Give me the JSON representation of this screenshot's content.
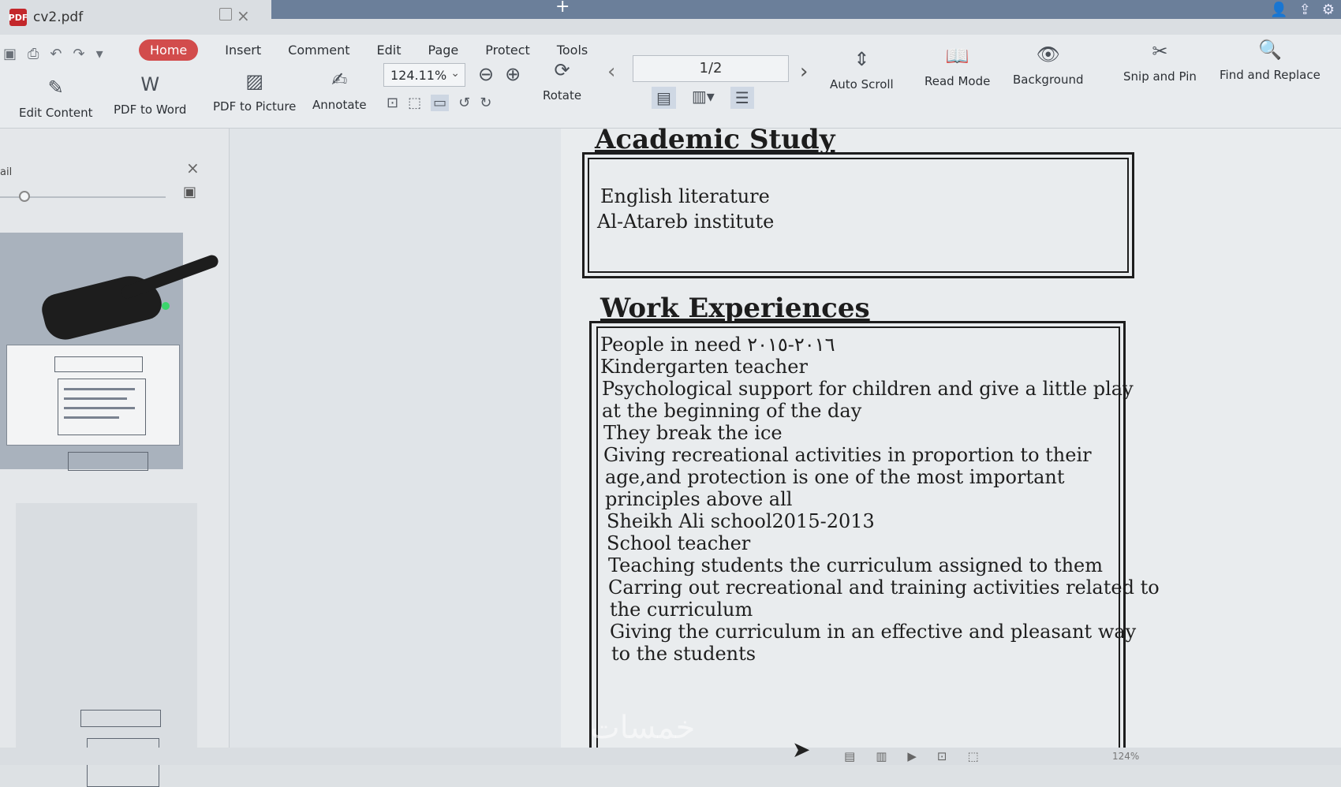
{
  "window": {
    "file_name": "cv2.pdf",
    "logo_text": "PDF"
  },
  "menu": {
    "items": [
      "Home",
      "Insert",
      "Comment",
      "Edit",
      "Page",
      "Protect",
      "Tools"
    ],
    "active": "Home"
  },
  "toolbar": {
    "edit_content": "Edit Content",
    "pdf_to_word": "PDF to Word",
    "pdf_to_picture": "PDF to Picture",
    "annotate": "Annotate",
    "zoom_value": "124.11%",
    "rotate": "Rotate",
    "page_indicator": "1/2",
    "auto_scroll": "Auto Scroll",
    "read_mode": "Read Mode",
    "background": "Background",
    "snip_and_pin": "Snip and Pin",
    "find_and_replace": "Find and Replace"
  },
  "left_panel": {
    "label": "ail"
  },
  "document": {
    "academic": {
      "title": "Academic Study",
      "lines": [
        "English literature",
        "Al-Atareb institute"
      ]
    },
    "work": {
      "title": "Work Experiences",
      "lines": [
        "People in need ٢٠١٦-٢٠١٥",
        "Kindergarten teacher",
        "Psychological support for children and give a little play",
        "at the  beginning of the day",
        " They break the ice",
        "Giving recreational activities in proportion to their",
        "age,and protection is one of the most important",
        "principles above all",
        "Sheikh Ali school2015-2013",
        "School teacher",
        "Teaching students the curriculum assigned to them",
        "Carring out recreational and training activities related to",
        "the curriculum",
        "Giving the curriculum in an effective and pleasant way",
        "to the students"
      ]
    }
  },
  "status_bar": {
    "zoom": "124%"
  },
  "watermark": "خمسات",
  "colors": {
    "accent_active_tab": "#d24c4c",
    "title_bar_blue": "#6b7f9a"
  }
}
